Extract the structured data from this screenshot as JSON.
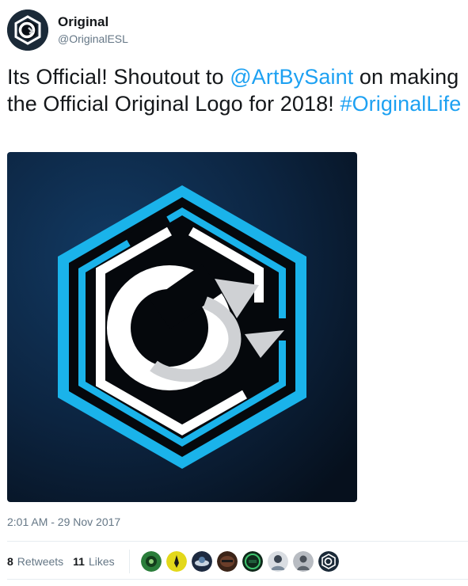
{
  "author": {
    "display_name": "Original",
    "handle": "@OriginalESL",
    "avatar_icon": "original-logo-icon"
  },
  "tweet": {
    "text_part1": "Its Official! Shoutout to ",
    "mention": "@ArtBySaint",
    "text_part2": " on making the Official Original Logo for 2018! ",
    "hashtag": "#OriginalLife",
    "link_color": "#1da1f2"
  },
  "media": {
    "image_icon": "original-logo-icon",
    "accent_color": "#1ab3ea",
    "background_color": "#0b1d33"
  },
  "timestamp": "2:01 AM - 29 Nov 2017",
  "stats": {
    "retweets_count": "8",
    "retweets_label": "Retweets",
    "likes_count": "11",
    "likes_label": "Likes"
  },
  "likers": [
    {
      "icon": "green-avatar-icon",
      "color": "#2a7d3a"
    },
    {
      "icon": "yellow-avatar-icon",
      "color": "#e3d81a"
    },
    {
      "icon": "dark-avatar-icon",
      "color": "#1d2a40"
    },
    {
      "icon": "brown-avatar-icon",
      "color": "#6b3e2a"
    },
    {
      "icon": "green-logo-avatar-icon",
      "color": "#1f5f3b"
    },
    {
      "icon": "person-avatar-icon",
      "color": "#7a8a9a"
    },
    {
      "icon": "grey-avatar-icon",
      "color": "#b8bcc2"
    },
    {
      "icon": "original-logo-icon",
      "color": "#1b2a38"
    }
  ]
}
